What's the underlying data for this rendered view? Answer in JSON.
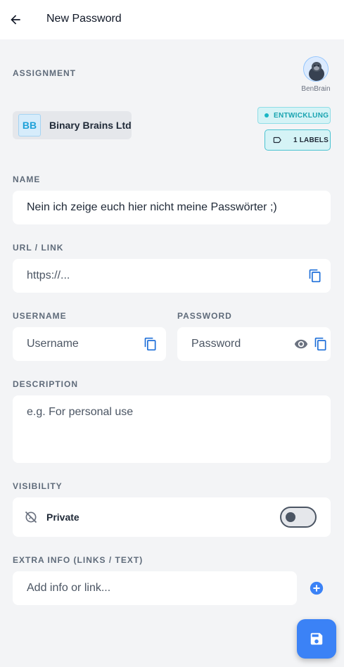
{
  "header": {
    "title": "New Password"
  },
  "assignment": {
    "label": "ASSIGNMENT",
    "user_name": "BenBrain",
    "company": {
      "initials": "BB",
      "name": "Binary Brains Ltd"
    },
    "environment_tag": "ENTWICKLUNG",
    "labels_tag": "1 LABELS"
  },
  "name": {
    "label": "NAME",
    "value": "Nein ich zeige euch hier nicht meine Passwörter ;)"
  },
  "url": {
    "label": "URL / LINK",
    "placeholder": "https://..."
  },
  "username": {
    "label": "USERNAME",
    "placeholder": "Username"
  },
  "password": {
    "label": "PASSWORD",
    "placeholder": "Password"
  },
  "description": {
    "label": "DESCRIPTION",
    "placeholder": "e.g. For personal use"
  },
  "visibility": {
    "label": "VISIBILITY",
    "option_label": "Private",
    "enabled": false
  },
  "extra_info": {
    "label": "EXTRA INFO (LINKS / TEXT)",
    "placeholder": "Add info or link..."
  },
  "icons": {
    "back": "arrow-left-icon",
    "copy": "copy-icon",
    "eye": "eye-icon",
    "private": "visibility-off-icon",
    "add": "add-circle-icon",
    "save": "save-icon",
    "label": "label-icon"
  },
  "colors": {
    "accent": "#3b82f6",
    "copy_icon": "#1e6fd9",
    "tag_bg": "#d5f3f6",
    "tag_text": "#18a3b0",
    "company_initials": "#1ea1d8"
  }
}
